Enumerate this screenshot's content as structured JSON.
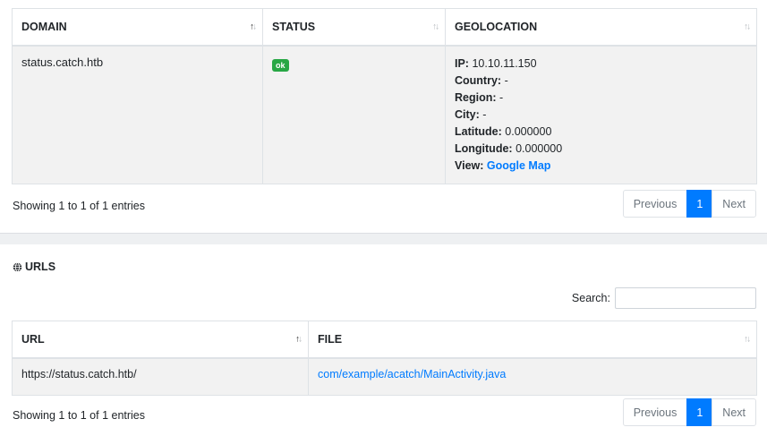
{
  "domain_table": {
    "columns": [
      "DOMAIN",
      "STATUS",
      "GEOLOCATION"
    ],
    "rows": [
      {
        "domain": "status.catch.htb",
        "status": "ok",
        "geo": {
          "ip_label": "IP:",
          "ip": "10.10.11.150",
          "country_label": "Country:",
          "country": "-",
          "region_label": "Region:",
          "region": "-",
          "city_label": "City:",
          "city": "-",
          "latitude_label": "Latitude:",
          "latitude": "0.000000",
          "longitude_label": "Longitude:",
          "longitude": "0.000000",
          "view_label": "View:",
          "view_link": "Google Map"
        }
      }
    ],
    "info": "Showing 1 to 1 of 1 entries",
    "pager": {
      "previous": "Previous",
      "page": "1",
      "next": "Next"
    }
  },
  "urls_section": {
    "heading": "URLS",
    "search_label": "Search:",
    "search_value": "",
    "columns": [
      "URL",
      "FILE"
    ],
    "rows": [
      {
        "url": "https://status.catch.htb/",
        "file": "com/example/acatch/MainActivity.java"
      }
    ],
    "info": "Showing 1 to 1 of 1 entries",
    "pager": {
      "previous": "Previous",
      "page": "1",
      "next": "Next"
    }
  },
  "colors": {
    "accent": "#007bff",
    "badge_ok": "#28a745",
    "row_bg": "#f2f2f2"
  },
  "icons": {
    "section_icon": "globe-icon",
    "sort_icon": "sort-arrows-icon"
  }
}
